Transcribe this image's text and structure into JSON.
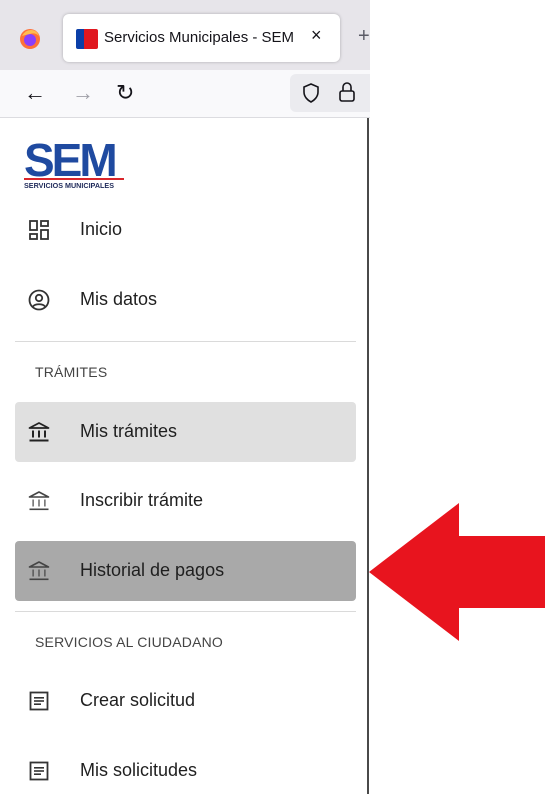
{
  "browser": {
    "tab_title": "Servicios Municipales - SEM",
    "tab_close": "×",
    "new_tab": "+",
    "back": "←",
    "forward": "→",
    "reload": "↻"
  },
  "logo": {
    "wordmark": "SEM",
    "subtitle": "SERVICIOS MUNICIPALES"
  },
  "sidebar": {
    "items_top": [
      {
        "label": "Inicio",
        "icon": "dashboard-icon"
      },
      {
        "label": "Mis datos",
        "icon": "account-circle-icon"
      }
    ],
    "section_tramites": "TRÁMITES",
    "tramites": [
      {
        "label": "Mis trámites",
        "icon": "bank-icon",
        "state": "active"
      },
      {
        "label": "Inscribir trámite",
        "icon": "bank-icon"
      },
      {
        "label": "Historial de pagos",
        "icon": "bank-icon",
        "state": "hover"
      }
    ],
    "section_servicios": "SERVICIOS AL CIUDADANO",
    "servicios": [
      {
        "label": "Crear solicitud",
        "icon": "article-icon"
      },
      {
        "label": "Mis solicitudes",
        "icon": "article-icon"
      }
    ]
  },
  "colors": {
    "active_bg": "#e0e0e0",
    "hover_bg": "#a9a9a9",
    "arrow": "#e8141e",
    "logo_blue": "#1f4aa0",
    "logo_red": "#d9262b"
  }
}
